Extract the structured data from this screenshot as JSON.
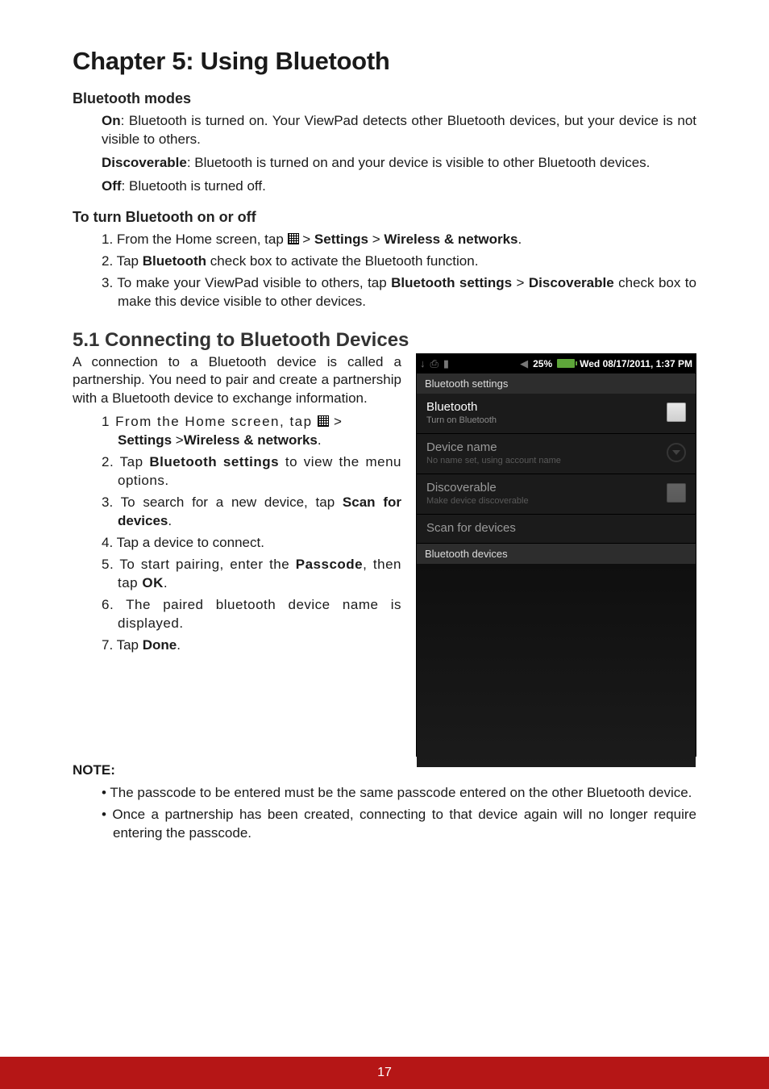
{
  "chapter_title": "Chapter 5: Using Bluetooth",
  "modes": {
    "heading": "Bluetooth modes",
    "on": {
      "label": "On",
      "text": ": Bluetooth is turned on. Your ViewPad detects other Bluetooth devices, but your device is not visible to others."
    },
    "discoverable": {
      "label": "Discoverable",
      "text": ": Bluetooth is turned on and your device is visible to other Bluetooth devices."
    },
    "off": {
      "label": "Off",
      "text": ": Bluetooth is turned off."
    }
  },
  "toggle": {
    "heading": "To turn Bluetooth on or off",
    "step1_a": "1. From the Home screen, tap ",
    "step1_b": " > ",
    "step1_c": "Settings",
    "step1_d": " > ",
    "step1_e": "Wireless & networks",
    "step1_f": ".",
    "step2_a": "2. Tap ",
    "step2_b": "Bluetooth",
    "step2_c": " check box to activate the Bluetooth function.",
    "step3_a": "3. To make your ViewPad visible to others, tap ",
    "step3_b": "Bluetooth settings",
    "step3_c": " > ",
    "step3_d": "Discoverable",
    "step3_e": " check box to make this device visible to other devices."
  },
  "connect": {
    "heading": "5.1 Connecting to Bluetooth Devices",
    "intro": "A connection to a Bluetooth device is called a partnership. You need to pair and create a partnership with a Bluetooth device to exchange information.",
    "step1_a": "1  From the Home screen, tap ",
    "step1_b": "  >  ",
    "step1_c": "Settings",
    "step1_d": " >",
    "step1_e": "Wireless & networks",
    "step1_f": ".",
    "step2_a": "2. Tap ",
    "step2_b": "Bluetooth settings",
    "step2_c": " to view the menu options.",
    "step3_a": "3. To search for a new device, tap ",
    "step3_b": "Scan for devices",
    "step3_c": ".",
    "step4": "4. Tap a device to connect.",
    "step5_a": "5. To start pairing, enter the ",
    "step5_b": "Passcode",
    "step5_c": ", then tap ",
    "step5_d": "OK",
    "step5_e": ".",
    "step6": "6. The paired bluetooth device name is displayed.",
    "step7_a": "7. Tap ",
    "step7_b": "Done",
    "step7_c": "."
  },
  "note": {
    "label": "NOTE",
    "colon": ":",
    "b1": "The passcode to be entered must be the same passcode entered on the other Bluetooth device.",
    "b2": "Once a partnership has been created, connecting to that device again will no longer require entering the passcode."
  },
  "footer": {
    "page": "17"
  },
  "screenshot": {
    "status": {
      "volume_glyph": "◀",
      "percent": "25%",
      "time": "Wed 08/17/2011, 1:37 PM",
      "icons": {
        "download": "↓",
        "usb": "⎙",
        "battery": "▮"
      }
    },
    "header1": "Bluetooth settings",
    "row_bluetooth": {
      "title": "Bluetooth",
      "sub": "Turn on Bluetooth"
    },
    "row_devicename": {
      "title": "Device name",
      "sub": "No name set, using account name"
    },
    "row_discoverable": {
      "title": "Discoverable",
      "sub": "Make device discoverable"
    },
    "row_scan": {
      "title": "Scan for devices"
    },
    "header2": "Bluetooth devices"
  }
}
